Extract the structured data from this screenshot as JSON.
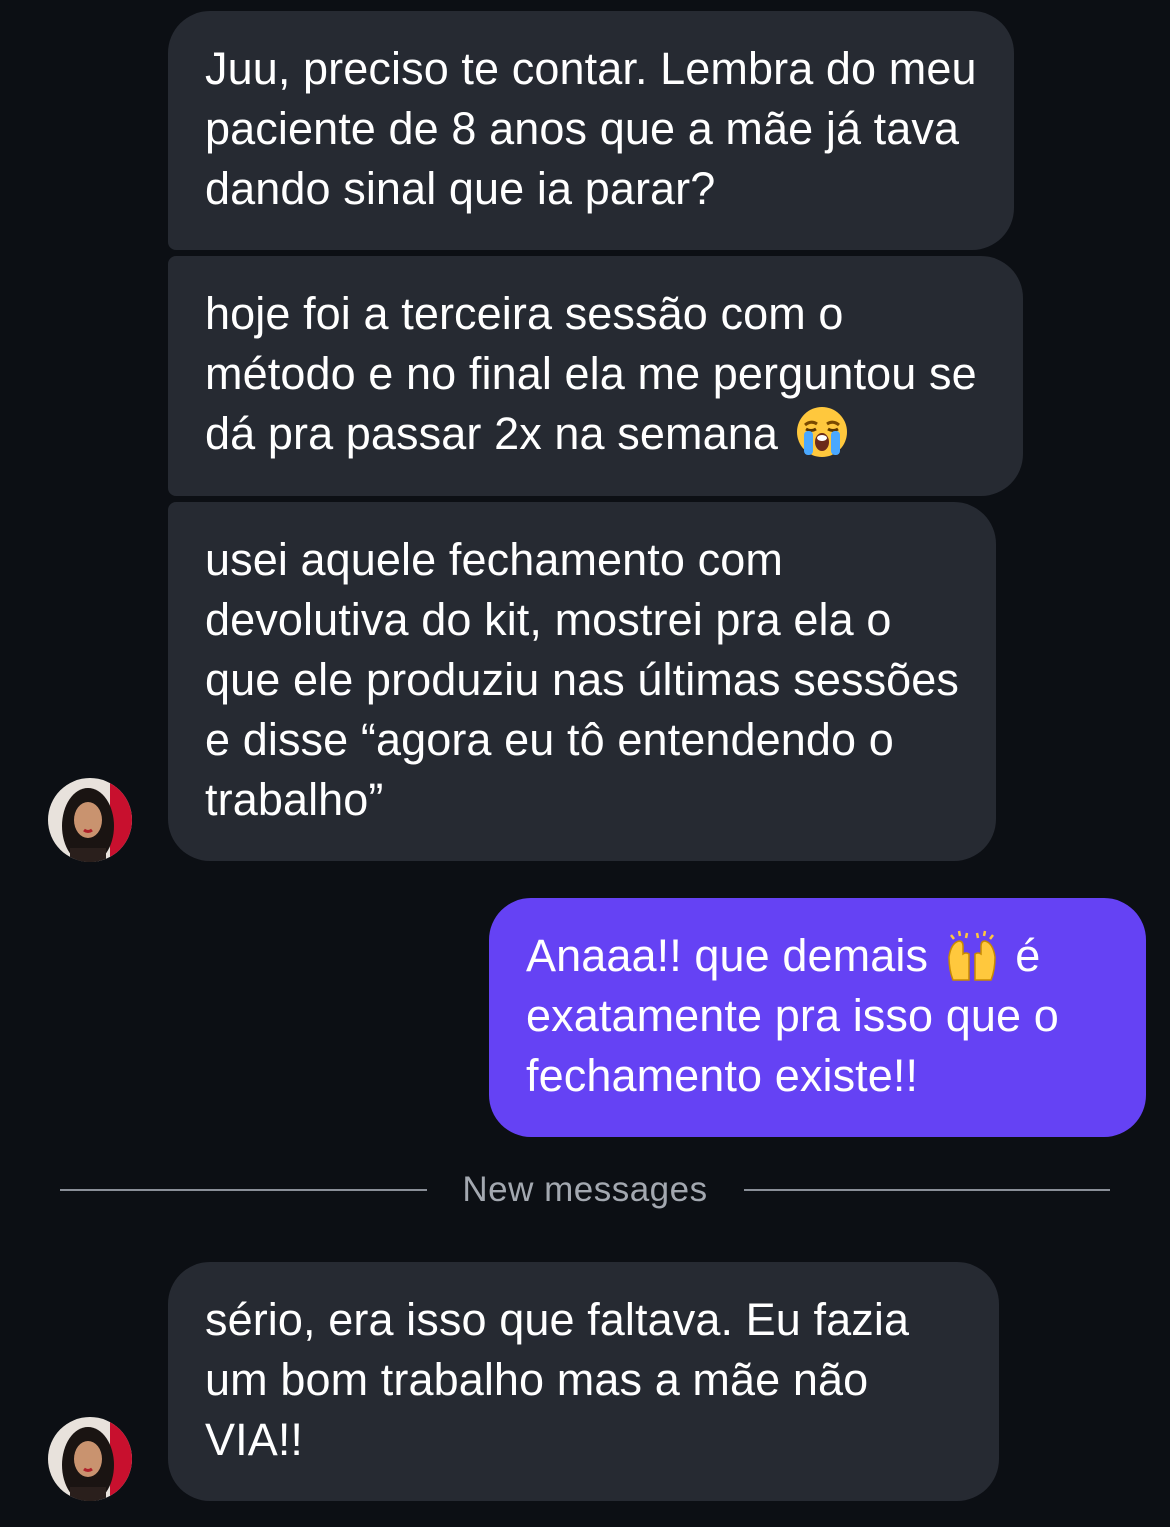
{
  "messages": [
    {
      "sender": "contact",
      "text": "Juu, preciso te contar. Lembra do meu paciente de 8 anos que a mãe já tava dando sinal que ia parar?"
    },
    {
      "sender": "contact",
      "text": "hoje foi a terceira sessão com o método e no final ela me perguntou se dá pra passar 2x na semana",
      "emoji": "loudly-crying-face-emoji"
    },
    {
      "sender": "contact",
      "text": "usei aquele fechamento com devolutiva do kit, mostrei pra ela o que ele produziu nas últimas sessões e disse “agora eu tô entendendo o trabalho”",
      "avatar": "contact-avatar"
    },
    {
      "sender": "me",
      "text_before": "Anaaa!! que demais",
      "emoji": "raising-hands-emoji",
      "text_after": "é exatamente pra isso que o fechamento existe!!"
    },
    {
      "sender": "contact",
      "text": "sério, era isso que faltava. Eu fazia um bom trabalho mas a mãe não VIA!!",
      "avatar": "contact-avatar"
    }
  ],
  "divider": {
    "label": "New messages"
  },
  "colors": {
    "background": "#0c0f14",
    "incoming_bubble": "#262a32",
    "outgoing_bubble": "#6542f4",
    "text": "#ffffff",
    "divider": "#8a8f98"
  }
}
